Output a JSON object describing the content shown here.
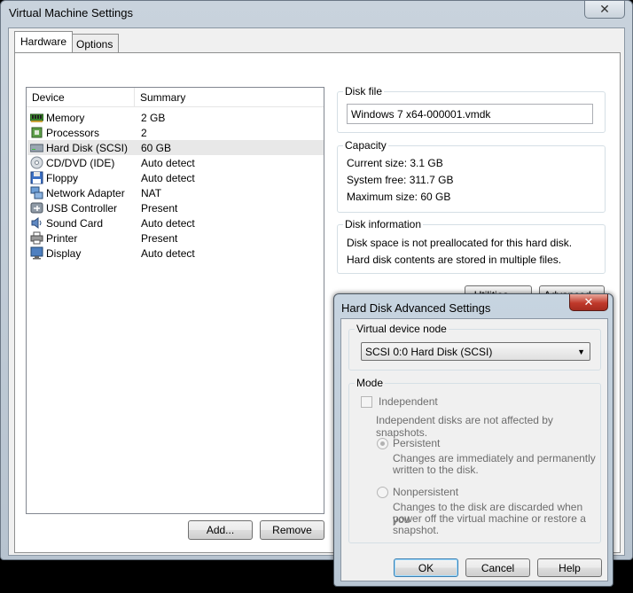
{
  "main_window": {
    "title": "Virtual Machine Settings",
    "tabs": [
      {
        "label": "Hardware",
        "active": true
      },
      {
        "label": "Options",
        "active": false
      }
    ],
    "device_list": {
      "headers": {
        "device": "Device",
        "summary": "Summary"
      },
      "rows": [
        {
          "device": "Memory",
          "summary": "2 GB",
          "icon": "memory-icon"
        },
        {
          "device": "Processors",
          "summary": "2",
          "icon": "processor-icon"
        },
        {
          "device": "Hard Disk (SCSI)",
          "summary": "60 GB",
          "icon": "hard-disk-icon",
          "selected": true
        },
        {
          "device": "CD/DVD (IDE)",
          "summary": "Auto detect",
          "icon": "cd-dvd-icon"
        },
        {
          "device": "Floppy",
          "summary": "Auto detect",
          "icon": "floppy-icon"
        },
        {
          "device": "Network Adapter",
          "summary": "NAT",
          "icon": "network-adapter-icon"
        },
        {
          "device": "USB Controller",
          "summary": "Present",
          "icon": "usb-controller-icon"
        },
        {
          "device": "Sound Card",
          "summary": "Auto detect",
          "icon": "sound-card-icon"
        },
        {
          "device": "Printer",
          "summary": "Present",
          "icon": "printer-icon"
        },
        {
          "device": "Display",
          "summary": "Auto detect",
          "icon": "display-icon"
        }
      ]
    },
    "buttons": {
      "add": "Add...",
      "remove": "Remove"
    },
    "disk_file": {
      "legend": "Disk file",
      "value": "Windows 7 x64-000001.vmdk"
    },
    "capacity": {
      "legend": "Capacity",
      "current_size": "Current size:  3.1 GB",
      "system_free": "System free:  311.7 GB",
      "maximum_size": "Maximum size:  60 GB"
    },
    "disk_information": {
      "legend": "Disk information",
      "line1": "Disk space is not preallocated for this hard disk.",
      "line2": "Hard disk contents are stored in multiple files."
    },
    "utilities_label": "Utilities",
    "advanced_label": "Advanced...",
    "close_glyph": "✕"
  },
  "dialog": {
    "title": "Hard Disk Advanced Settings",
    "close_glyph": "✕",
    "virtual_device_node": {
      "legend": "Virtual device node",
      "selected": "SCSI 0:0   Hard Disk (SCSI)"
    },
    "mode": {
      "legend": "Mode",
      "independent_label": "Independent",
      "independent_desc": "Independent disks are not affected by snapshots.",
      "persistent_label": "Persistent",
      "persistent_desc_1": "Changes are immediately and permanently",
      "persistent_desc_2": "written to the disk.",
      "nonpersistent_label": "Nonpersistent",
      "nonpersistent_desc_1": "Changes to the disk are discarded when you",
      "nonpersistent_desc_2": "power off the virtual machine or restore a",
      "nonpersistent_desc_3": "snapshot."
    },
    "buttons": {
      "ok": "OK",
      "cancel": "Cancel",
      "help": "Help"
    }
  }
}
